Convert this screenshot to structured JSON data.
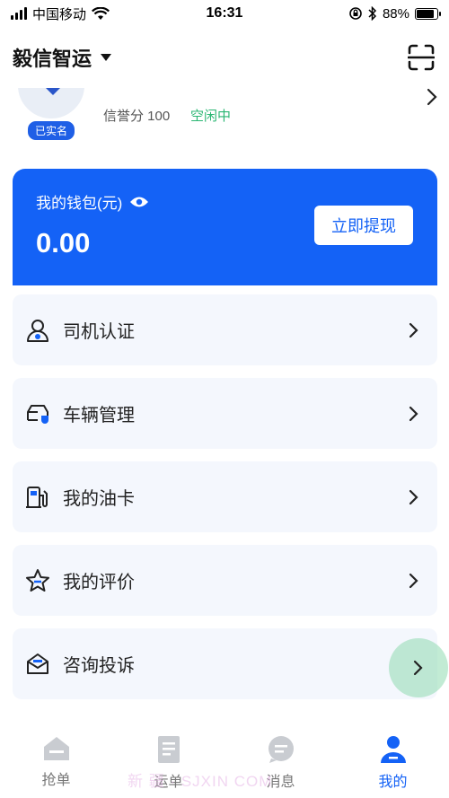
{
  "status_bar": {
    "carrier": "中国移动",
    "time": "16:31",
    "battery_percent": "88%",
    "battery_level": 0.88
  },
  "header": {
    "title": "毅信智运"
  },
  "profile": {
    "verified_badge": "已实名",
    "credit_score": "信誉分 100",
    "status": "空闲中"
  },
  "wallet": {
    "label": "我的钱包(元)",
    "amount": "0.00",
    "withdraw_label": "立即提现"
  },
  "menu": [
    {
      "label": "司机认证",
      "icon": "driver-icon"
    },
    {
      "label": "车辆管理",
      "icon": "vehicle-icon"
    },
    {
      "label": "我的油卡",
      "icon": "fuel-icon"
    },
    {
      "label": "我的评价",
      "icon": "star-icon"
    },
    {
      "label": "咨询投诉",
      "icon": "mail-icon"
    }
  ],
  "tabbar": [
    {
      "label": "抢单",
      "icon": "home-icon",
      "active": false
    },
    {
      "label": "运单",
      "icon": "document-icon",
      "active": false
    },
    {
      "label": "消息",
      "icon": "message-icon",
      "active": false
    },
    {
      "label": "我的",
      "icon": "user-icon",
      "active": true
    }
  ],
  "watermark": "新 疆 · SJXIN COM",
  "colors": {
    "accent": "#1462f6",
    "status_idle": "#2bb673",
    "menu_bg": "#f4f7fd"
  }
}
